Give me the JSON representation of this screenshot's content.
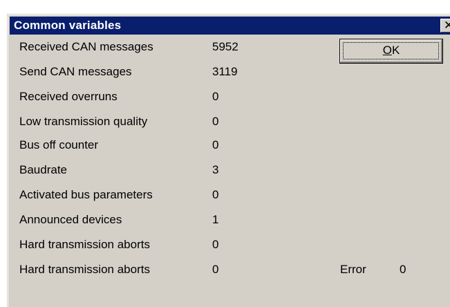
{
  "window": {
    "title": "Common variables",
    "close_glyph": "✕",
    "close_icon": "close-icon"
  },
  "variables": [
    {
      "label": "Received CAN messages",
      "value": "5952"
    },
    {
      "label": "Send CAN messages",
      "value": "3119"
    },
    {
      "label": "Received overruns",
      "value": "0"
    },
    {
      "label": "Low transmission quality",
      "value": "0"
    },
    {
      "label": "Bus off counter",
      "value": "0"
    },
    {
      "label": "Baudrate",
      "value": "3"
    },
    {
      "label": "Activated bus parameters",
      "value": "0"
    },
    {
      "label": "Announced devices",
      "value": "1"
    },
    {
      "label": "Hard transmission aborts",
      "value": "0"
    },
    {
      "label": "Hard transmission aborts",
      "value": "0"
    }
  ],
  "ok_button": {
    "mnemonic": "O",
    "rest": "K"
  },
  "error": {
    "label": "Error",
    "value": "0"
  },
  "colors": {
    "titlebar": "#0a1e6e",
    "dialog_face": "#d4d0c8",
    "title_text": "#ffffff"
  }
}
